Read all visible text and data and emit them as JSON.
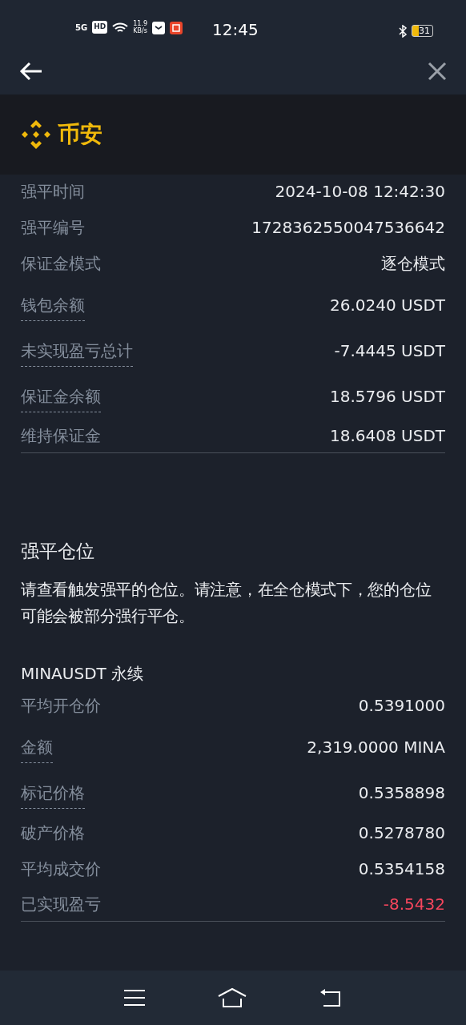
{
  "status_bar": {
    "network": "5G",
    "hd": "HD",
    "speed_value": "11.9",
    "speed_unit": "KB/s",
    "time": "12:45",
    "battery": "31"
  },
  "logo": {
    "text": "币安"
  },
  "details": [
    {
      "label": "强平时间",
      "value": "2024-10-08 12:42:30",
      "dotted": false
    },
    {
      "label": "强平编号",
      "value": "1728362550047536642",
      "dotted": false
    },
    {
      "label": "保证金模式",
      "value": "逐仓模式",
      "dotted": false
    },
    {
      "label": "钱包余额",
      "value": "26.0240 USDT",
      "dotted": true
    },
    {
      "label": "未实现盈亏总计",
      "value": "-7.4445 USDT",
      "dotted": true
    },
    {
      "label": "保证金余额",
      "value": "18.5796 USDT",
      "dotted": true
    },
    {
      "label": "维持保证金",
      "value": "18.6408 USDT",
      "dotted": false
    }
  ],
  "section": {
    "title": "强平仓位",
    "note": "请查看触发强平的仓位。请注意，在全仓模式下，您的仓位可能会被部分强行平仓。"
  },
  "position": {
    "symbol": "MINAUSDT 永续",
    "rows": [
      {
        "label": "平均开仓价",
        "value": "0.5391000",
        "dotted": false,
        "loss": false
      },
      {
        "label": "金额",
        "value": "2,319.0000 MINA",
        "dotted": true,
        "loss": false
      },
      {
        "label": "标记价格",
        "value": "0.5358898",
        "dotted": true,
        "loss": false
      },
      {
        "label": "破产价格",
        "value": "0.5278780",
        "dotted": false,
        "loss": false
      },
      {
        "label": "平均成交价",
        "value": "0.5354158",
        "dotted": false,
        "loss": false
      },
      {
        "label": "已实现盈亏",
        "value": "-8.5432",
        "dotted": false,
        "loss": true
      }
    ]
  }
}
